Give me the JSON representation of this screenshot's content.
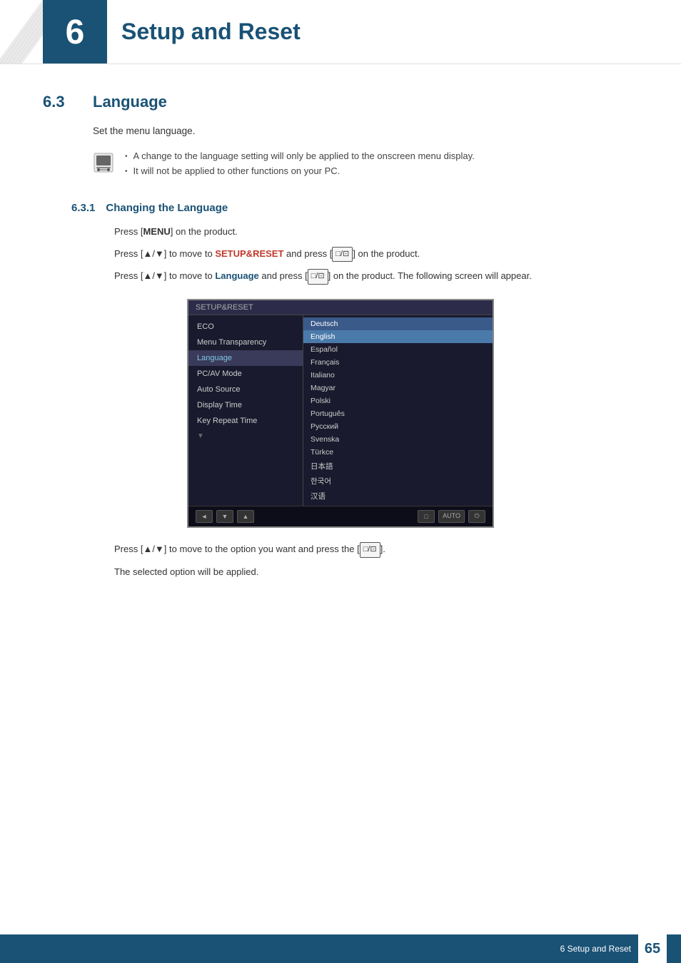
{
  "header": {
    "chapter_number": "6",
    "chapter_title": "Setup and Reset"
  },
  "section": {
    "number": "6.3",
    "title": "Language",
    "description": "Set the menu language.",
    "notes": [
      "A change to the language setting will only be applied to the onscreen menu display.",
      "It will not be applied to other functions on your PC."
    ]
  },
  "subsection": {
    "number": "6.3.1",
    "title": "Changing the Language",
    "steps": [
      "Press [MENU] on the product.",
      "Press [▲/▼] to move to SETUP&RESET and press [□/⊡] on the product.",
      "Press [▲/▼] to move to Language and press [□/⊡] on the product. The following screen will appear.",
      "Press [▲/▼] to move to the option you want and press the [□/⊡].",
      "The selected option will be applied."
    ]
  },
  "monitor": {
    "menu_title": "SETUP&RESET",
    "menu_items": [
      {
        "label": "ECO",
        "active": false
      },
      {
        "label": "Menu Transparency",
        "active": false
      },
      {
        "label": "Language",
        "active": true
      },
      {
        "label": "PC/AV Mode",
        "active": false
      },
      {
        "label": "Auto Source",
        "active": false
      },
      {
        "label": "Display Time",
        "active": false
      },
      {
        "label": "Key Repeat Time",
        "active": false
      }
    ],
    "languages": [
      {
        "name": "Deutsch",
        "selected": false
      },
      {
        "name": "English",
        "selected": true
      },
      {
        "name": "Español",
        "selected": false
      },
      {
        "name": "Français",
        "selected": false
      },
      {
        "name": "Italiano",
        "selected": false
      },
      {
        "name": "Magyar",
        "selected": false
      },
      {
        "name": "Polski",
        "selected": false
      },
      {
        "name": "Português",
        "selected": false
      },
      {
        "name": "Русский",
        "selected": false
      },
      {
        "name": "Svenska",
        "selected": false
      },
      {
        "name": "Türkce",
        "selected": false
      },
      {
        "name": "日本語",
        "selected": false
      },
      {
        "name": "한국어",
        "selected": false
      },
      {
        "name": "汉语",
        "selected": false
      }
    ]
  },
  "footer": {
    "text": "6 Setup and Reset",
    "page_number": "65"
  }
}
